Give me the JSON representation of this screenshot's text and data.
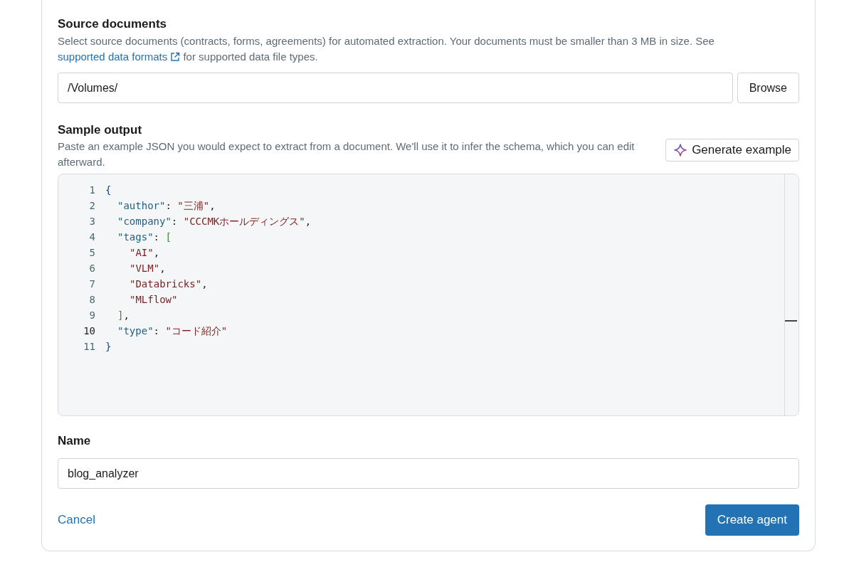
{
  "source": {
    "title": "Source documents",
    "description": "Select source documents (contracts, forms, agreements) for automated extraction. Your documents must be smaller than 3 MB in size. See",
    "link": "supported data formats",
    "description_end": "for supported data file types.",
    "path_value": "/Volumes/",
    "browse": "Browse"
  },
  "sample": {
    "title": "Sample output",
    "description": "Paste an example JSON you would expect to extract from a document. We'll use it to infer the schema, which you can edit afterward.",
    "generate": "Generate example",
    "code": [
      {
        "number": "1",
        "active": false,
        "tokens": [
          {
            "kind": "brace",
            "text": "{"
          }
        ],
        "children": [
          {
            "number": "2",
            "active": false,
            "tokens": [
              {
                "kind": "key",
                "text": "\"author\""
              },
              {
                "kind": "punct",
                "text": ": "
              },
              {
                "kind": "string",
                "text": "\"三浦\""
              },
              {
                "kind": "punct",
                "text": ","
              }
            ]
          },
          {
            "number": "3",
            "active": false,
            "tokens": [
              {
                "kind": "key",
                "text": "\"company\""
              },
              {
                "kind": "punct",
                "text": ": "
              },
              {
                "kind": "string",
                "text": "\"CCCMKホールディングス\""
              },
              {
                "kind": "punct",
                "text": ","
              }
            ]
          },
          {
            "number": "4",
            "active": false,
            "tokens": [
              {
                "kind": "key",
                "text": "\"tags\""
              },
              {
                "kind": "punct",
                "text": ": "
              },
              {
                "kind": "bracket",
                "text": "["
              }
            ],
            "children": [
              {
                "number": "5",
                "active": false,
                "tokens": [
                  {
                    "kind": "string",
                    "text": "\"AI\""
                  },
                  {
                    "kind": "punct",
                    "text": ","
                  }
                ]
              },
              {
                "number": "6",
                "active": false,
                "tokens": [
                  {
                    "kind": "string",
                    "text": "\"VLM\""
                  },
                  {
                    "kind": "punct",
                    "text": ","
                  }
                ]
              },
              {
                "number": "7",
                "active": false,
                "tokens": [
                  {
                    "kind": "string",
                    "text": "\"Databricks\""
                  },
                  {
                    "kind": "punct",
                    "text": ","
                  }
                ]
              },
              {
                "number": "8",
                "active": false,
                "tokens": [
                  {
                    "kind": "string",
                    "text": "\"MLflow\""
                  }
                ]
              }
            ]
          },
          {
            "number": "9",
            "active": false,
            "tokens": [
              {
                "kind": "bracket",
                "text": "]"
              },
              {
                "kind": "punct",
                "text": ","
              }
            ]
          },
          {
            "number": "10",
            "active": true,
            "tokens": [
              {
                "kind": "key",
                "text": "\"type\""
              },
              {
                "kind": "punct",
                "text": ": "
              },
              {
                "kind": "string",
                "text": "\"コード紹介\""
              }
            ]
          }
        ]
      },
      {
        "number": "11",
        "active": false,
        "tokens": [
          {
            "kind": "brace",
            "text": "}"
          }
        ]
      }
    ]
  },
  "name": {
    "label": "Name",
    "value": "blog_analyzer"
  },
  "actions": {
    "cancel": "Cancel",
    "create": "Create agent"
  }
}
